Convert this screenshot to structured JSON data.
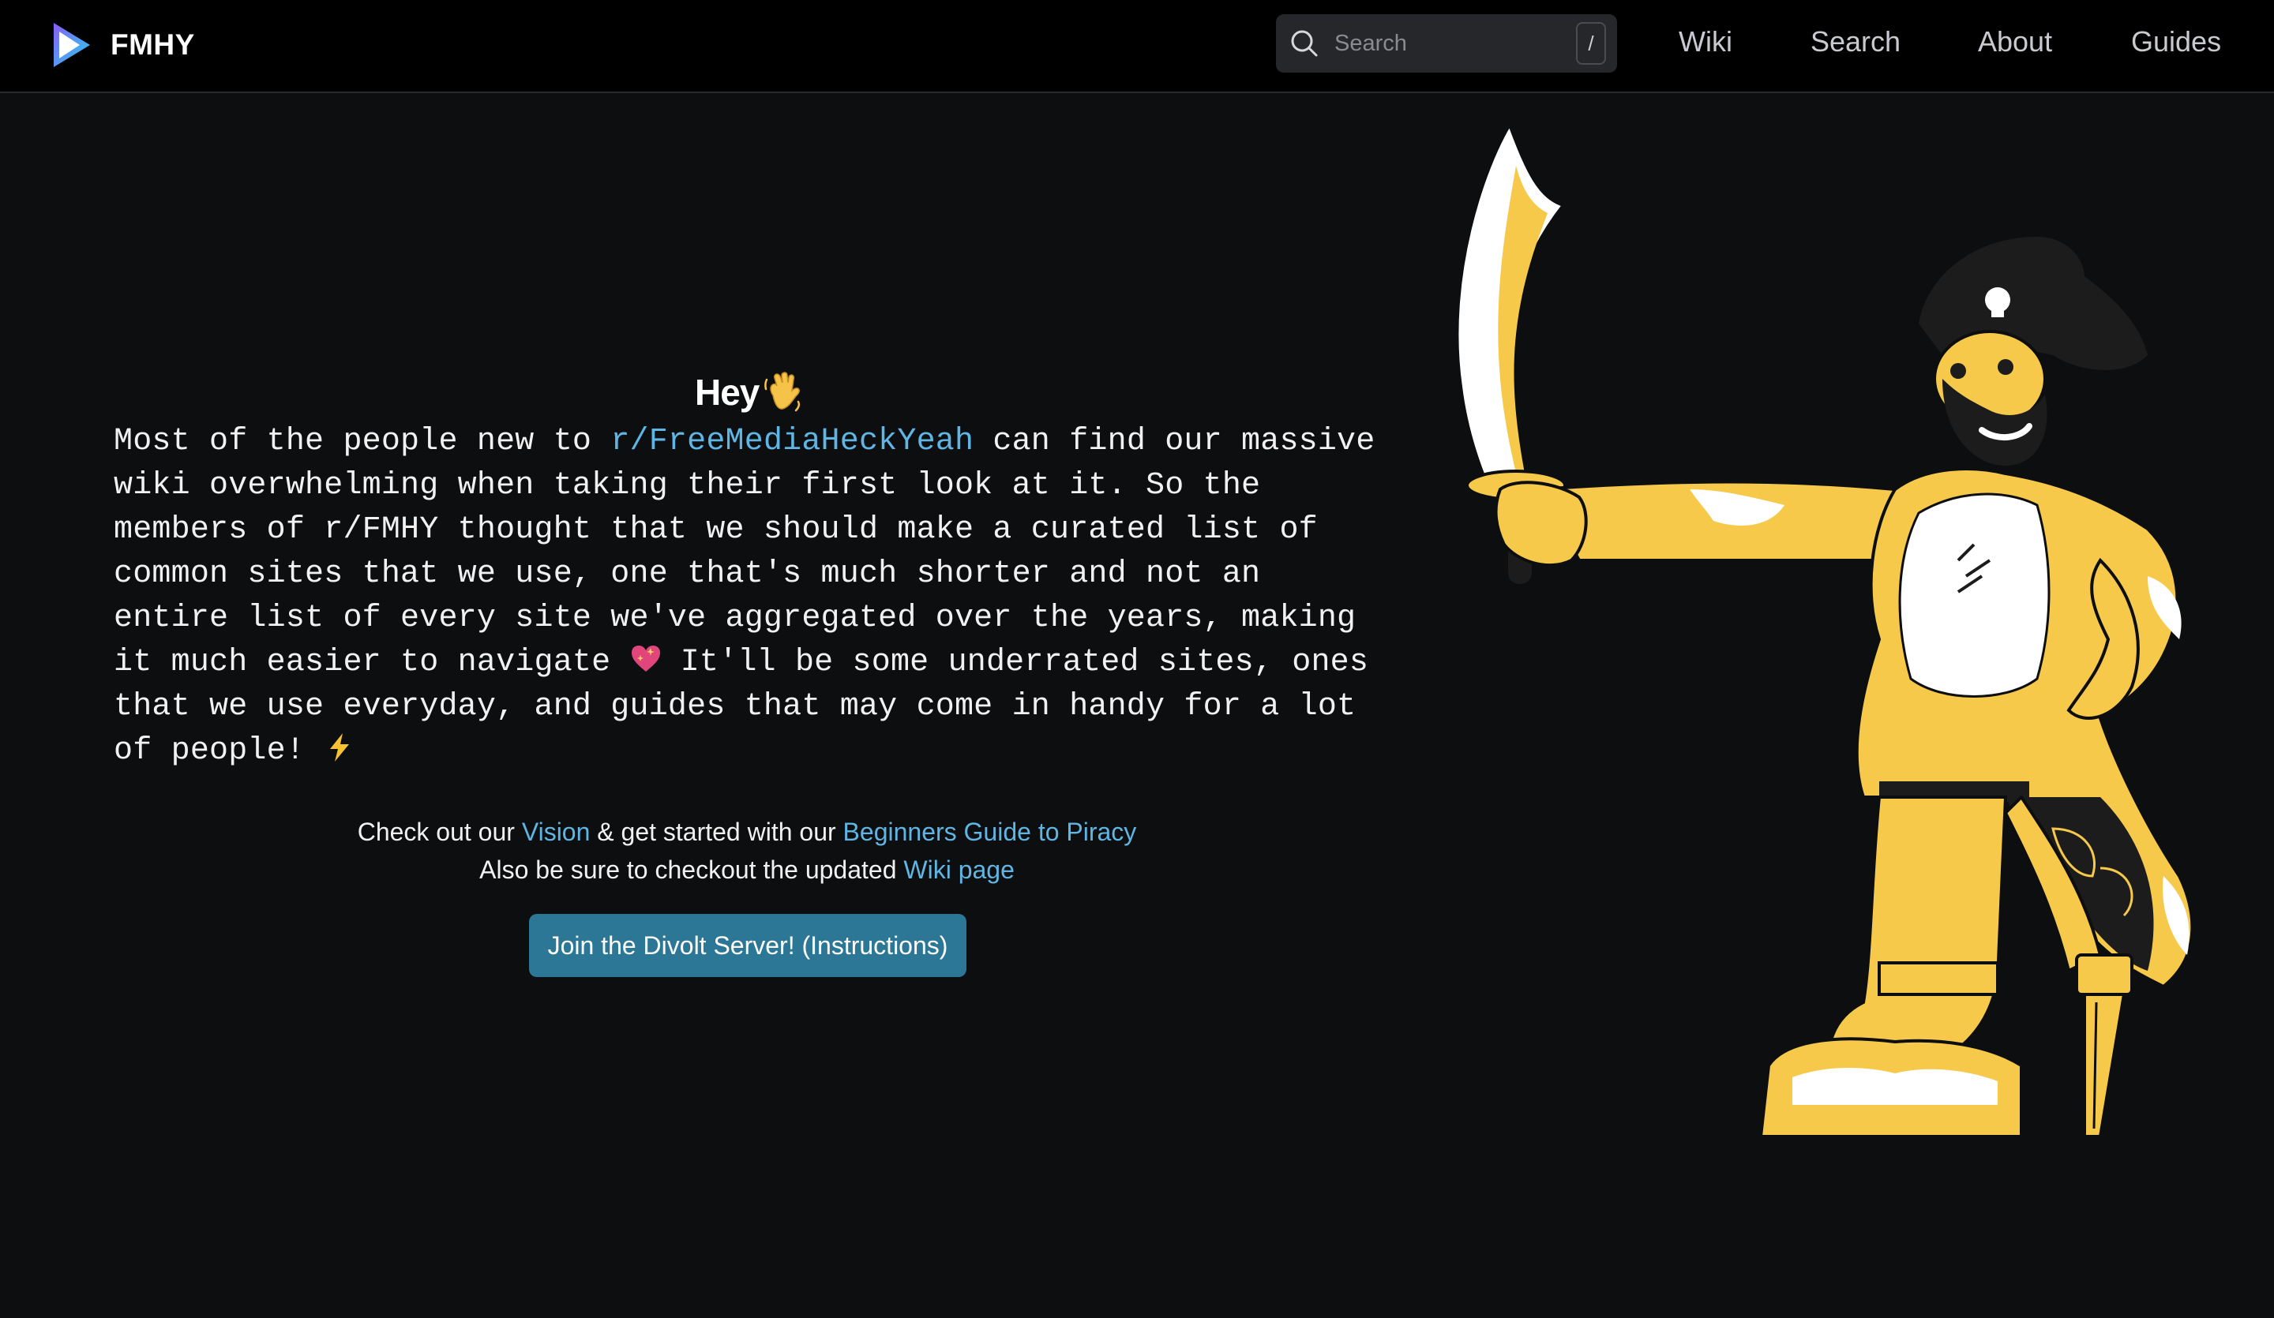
{
  "nav": {
    "brand": "FMHY",
    "search_placeholder": "Search",
    "search_shortcut": "/",
    "links": [
      {
        "label": "Wiki"
      },
      {
        "label": "Search"
      },
      {
        "label": "About"
      },
      {
        "label": "Guides"
      }
    ]
  },
  "hero": {
    "title": "Hey",
    "title_icon": "waving-hand-icon",
    "intro_before_link": "Most of the people new to ",
    "intro_link": "r/FreeMediaHeckYeah",
    "intro_after_link": " can find our massive\nwiki overwhelming when taking their first look at it. So the\nmembers of r/FMHY thought that we should make a curated list of\ncommon sites that we use, one that's much shorter and not an\nentire list of every site we've aggregated over the years, making\nit much easier to navigate ",
    "intro_heart_icon": "sparkling-heart-icon",
    "intro_after_heart": " It'll be some underrated sites, ones\nthat we use everyday, and guides that may come in handy for a lot\nof people! ",
    "intro_end_icon": "lightning-icon",
    "cta_line1_before": "Check out our ",
    "cta_vision_link": "Vision",
    "cta_line1_middle": " & get started with our ",
    "cta_guide_link": "Beginners Guide to Piracy",
    "cta_line2_before": "Also be sure to checkout the updated ",
    "cta_wiki_link": "Wiki page",
    "join_button": "Join the Divolt Server! (Instructions)"
  },
  "illustration": {
    "name": "pirate-illustration",
    "colors": {
      "yellow": "#f6c94a",
      "white": "#ffffff",
      "dark": "#1c1c1c"
    }
  },
  "theme": {
    "background": "#0d0e10",
    "navbar": "#000000",
    "accent_link": "#5fb6e4",
    "button": "#2b7795"
  }
}
